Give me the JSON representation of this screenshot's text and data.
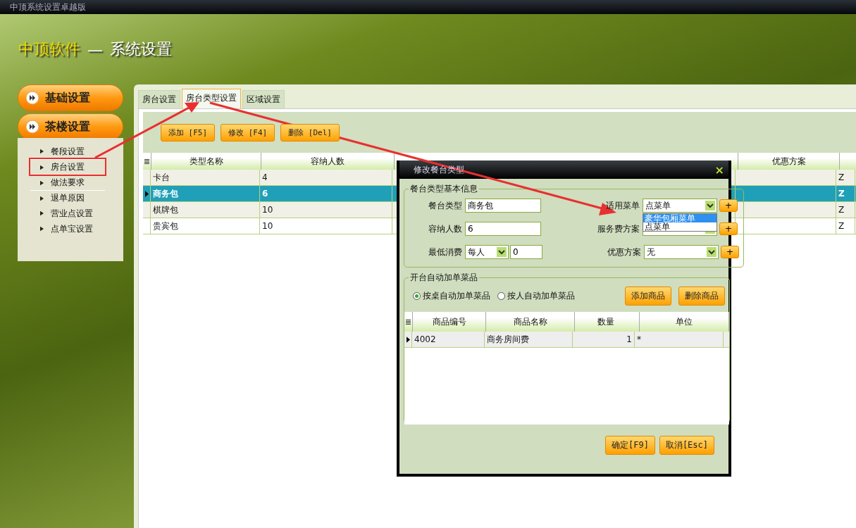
{
  "window": {
    "title": "中顶系统设置卓越版"
  },
  "header": {
    "brand": "中顶软件",
    "separator": "—",
    "title": "系统设置"
  },
  "sidebar": {
    "groups": [
      {
        "label": "基础设置"
      },
      {
        "label": "茶楼设置",
        "items": [
          {
            "label": "餐段设置",
            "highlighted": false
          },
          {
            "label": "房台设置",
            "highlighted": true
          },
          {
            "label": "做法要求",
            "highlighted": false
          },
          {
            "label": "退单原因",
            "highlighted": false
          },
          {
            "label": "营业点设置",
            "highlighted": false
          },
          {
            "label": "点单宝设置",
            "highlighted": false
          }
        ]
      }
    ]
  },
  "tabs": [
    {
      "label": "房台设置",
      "selected": false
    },
    {
      "label": "房台类型设置",
      "selected": true
    },
    {
      "label": "区域设置",
      "selected": false
    }
  ],
  "toolbar": {
    "buttons": [
      "添加 [F5]",
      "修改 [F4]",
      "删除 [Del]"
    ]
  },
  "table": {
    "columns": [
      "类型名称",
      "容纳人数",
      "优惠方案"
    ],
    "rows": [
      {
        "name": "卡台",
        "capacity": "4",
        "column_5": "Z",
        "selected": false
      },
      {
        "name": "商务包",
        "capacity": "6",
        "column_5": "Z",
        "selected": true
      },
      {
        "name": "棋牌包",
        "capacity": "10",
        "column_5": "Z",
        "selected": false
      },
      {
        "name": "贵宾包",
        "capacity": "10",
        "column_5": "Z",
        "selected": false
      }
    ]
  },
  "dialog": {
    "title": "修改餐台类型",
    "close": "×",
    "basic_info": {
      "legend": "餐台类型基本信息",
      "table_type": {
        "label": "餐台类型",
        "value": "商务包"
      },
      "capacity": {
        "label": "容纳人数",
        "value": "6"
      },
      "min_spend": {
        "label": "最低消费",
        "mode": "每人",
        "value": "0"
      },
      "menu": {
        "label": "适用菜单",
        "value": "点菜单",
        "add": "+"
      },
      "service_fee": {
        "label": "服务费方案",
        "add": "+"
      },
      "discount": {
        "label": "优惠方案",
        "value": "无",
        "add": "+"
      },
      "menu_options": [
        {
          "label": "豪华包厢菜单",
          "selected": true
        },
        {
          "label": "点菜单",
          "selected": false
        }
      ]
    },
    "auto_add": {
      "legend": "开台自动加单菜品",
      "radios": [
        {
          "label": "按桌自动加单菜品",
          "selected": true
        },
        {
          "label": "按人自动加单菜品",
          "selected": false
        }
      ],
      "buttons": [
        "添加商品",
        "删除商品"
      ],
      "columns": [
        "商品编号",
        "商品名称",
        "数量",
        "单位"
      ],
      "rows": [
        {
          "cells": [
            "4002",
            "商务房间费",
            "1",
            "*"
          ],
          "current": true
        }
      ]
    },
    "buttons": [
      "确定[F9]",
      "取消[Esc]"
    ]
  }
}
